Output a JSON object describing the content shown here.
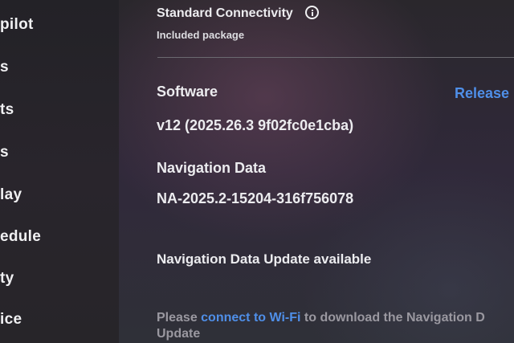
{
  "sidebar": {
    "items": [
      "pilot",
      "s",
      "ts",
      "s",
      "lay",
      "edule",
      "ty",
      "ice"
    ]
  },
  "connectivity": {
    "title": "Standard Connectivity",
    "subtitle": "Included package",
    "info_icon": "info-icon"
  },
  "software": {
    "heading": "Software",
    "release_link": "Release",
    "version": "v12 (2025.26.3 9f02fc0e1cba)"
  },
  "navigation": {
    "heading": "Navigation Data",
    "value": "NA-2025.2-15204-316f756078",
    "update_status": "Navigation Data Update available",
    "message_prefix": "Please ",
    "message_link": "connect to Wi-Fi",
    "message_suffix": " to download the Navigation D",
    "message_line2": "Update"
  },
  "colors": {
    "accent_link": "#4f8fe8",
    "background": "#2b2b30"
  }
}
